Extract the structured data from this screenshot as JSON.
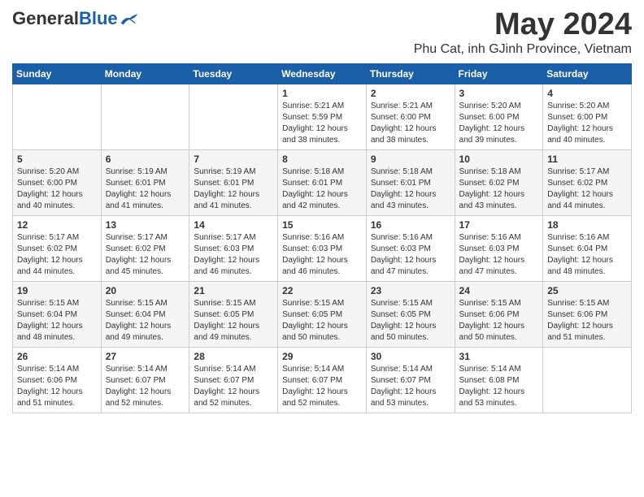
{
  "header": {
    "logo_general": "General",
    "logo_blue": "Blue",
    "month_year": "May 2024",
    "location": "Phu Cat, inh GJinh Province, Vietnam"
  },
  "days_of_week": [
    "Sunday",
    "Monday",
    "Tuesday",
    "Wednesday",
    "Thursday",
    "Friday",
    "Saturday"
  ],
  "weeks": [
    [
      {
        "day": "",
        "sunrise": "",
        "sunset": "",
        "daylight": ""
      },
      {
        "day": "",
        "sunrise": "",
        "sunset": "",
        "daylight": ""
      },
      {
        "day": "",
        "sunrise": "",
        "sunset": "",
        "daylight": ""
      },
      {
        "day": "1",
        "sunrise": "Sunrise: 5:21 AM",
        "sunset": "Sunset: 5:59 PM",
        "daylight": "Daylight: 12 hours and 38 minutes."
      },
      {
        "day": "2",
        "sunrise": "Sunrise: 5:21 AM",
        "sunset": "Sunset: 6:00 PM",
        "daylight": "Daylight: 12 hours and 38 minutes."
      },
      {
        "day": "3",
        "sunrise": "Sunrise: 5:20 AM",
        "sunset": "Sunset: 6:00 PM",
        "daylight": "Daylight: 12 hours and 39 minutes."
      },
      {
        "day": "4",
        "sunrise": "Sunrise: 5:20 AM",
        "sunset": "Sunset: 6:00 PM",
        "daylight": "Daylight: 12 hours and 40 minutes."
      }
    ],
    [
      {
        "day": "5",
        "sunrise": "Sunrise: 5:20 AM",
        "sunset": "Sunset: 6:00 PM",
        "daylight": "Daylight: 12 hours and 40 minutes."
      },
      {
        "day": "6",
        "sunrise": "Sunrise: 5:19 AM",
        "sunset": "Sunset: 6:01 PM",
        "daylight": "Daylight: 12 hours and 41 minutes."
      },
      {
        "day": "7",
        "sunrise": "Sunrise: 5:19 AM",
        "sunset": "Sunset: 6:01 PM",
        "daylight": "Daylight: 12 hours and 41 minutes."
      },
      {
        "day": "8",
        "sunrise": "Sunrise: 5:18 AM",
        "sunset": "Sunset: 6:01 PM",
        "daylight": "Daylight: 12 hours and 42 minutes."
      },
      {
        "day": "9",
        "sunrise": "Sunrise: 5:18 AM",
        "sunset": "Sunset: 6:01 PM",
        "daylight": "Daylight: 12 hours and 43 minutes."
      },
      {
        "day": "10",
        "sunrise": "Sunrise: 5:18 AM",
        "sunset": "Sunset: 6:02 PM",
        "daylight": "Daylight: 12 hours and 43 minutes."
      },
      {
        "day": "11",
        "sunrise": "Sunrise: 5:17 AM",
        "sunset": "Sunset: 6:02 PM",
        "daylight": "Daylight: 12 hours and 44 minutes."
      }
    ],
    [
      {
        "day": "12",
        "sunrise": "Sunrise: 5:17 AM",
        "sunset": "Sunset: 6:02 PM",
        "daylight": "Daylight: 12 hours and 44 minutes."
      },
      {
        "day": "13",
        "sunrise": "Sunrise: 5:17 AM",
        "sunset": "Sunset: 6:02 PM",
        "daylight": "Daylight: 12 hours and 45 minutes."
      },
      {
        "day": "14",
        "sunrise": "Sunrise: 5:17 AM",
        "sunset": "Sunset: 6:03 PM",
        "daylight": "Daylight: 12 hours and 46 minutes."
      },
      {
        "day": "15",
        "sunrise": "Sunrise: 5:16 AM",
        "sunset": "Sunset: 6:03 PM",
        "daylight": "Daylight: 12 hours and 46 minutes."
      },
      {
        "day": "16",
        "sunrise": "Sunrise: 5:16 AM",
        "sunset": "Sunset: 6:03 PM",
        "daylight": "Daylight: 12 hours and 47 minutes."
      },
      {
        "day": "17",
        "sunrise": "Sunrise: 5:16 AM",
        "sunset": "Sunset: 6:03 PM",
        "daylight": "Daylight: 12 hours and 47 minutes."
      },
      {
        "day": "18",
        "sunrise": "Sunrise: 5:16 AM",
        "sunset": "Sunset: 6:04 PM",
        "daylight": "Daylight: 12 hours and 48 minutes."
      }
    ],
    [
      {
        "day": "19",
        "sunrise": "Sunrise: 5:15 AM",
        "sunset": "Sunset: 6:04 PM",
        "daylight": "Daylight: 12 hours and 48 minutes."
      },
      {
        "day": "20",
        "sunrise": "Sunrise: 5:15 AM",
        "sunset": "Sunset: 6:04 PM",
        "daylight": "Daylight: 12 hours and 49 minutes."
      },
      {
        "day": "21",
        "sunrise": "Sunrise: 5:15 AM",
        "sunset": "Sunset: 6:05 PM",
        "daylight": "Daylight: 12 hours and 49 minutes."
      },
      {
        "day": "22",
        "sunrise": "Sunrise: 5:15 AM",
        "sunset": "Sunset: 6:05 PM",
        "daylight": "Daylight: 12 hours and 50 minutes."
      },
      {
        "day": "23",
        "sunrise": "Sunrise: 5:15 AM",
        "sunset": "Sunset: 6:05 PM",
        "daylight": "Daylight: 12 hours and 50 minutes."
      },
      {
        "day": "24",
        "sunrise": "Sunrise: 5:15 AM",
        "sunset": "Sunset: 6:06 PM",
        "daylight": "Daylight: 12 hours and 50 minutes."
      },
      {
        "day": "25",
        "sunrise": "Sunrise: 5:15 AM",
        "sunset": "Sunset: 6:06 PM",
        "daylight": "Daylight: 12 hours and 51 minutes."
      }
    ],
    [
      {
        "day": "26",
        "sunrise": "Sunrise: 5:14 AM",
        "sunset": "Sunset: 6:06 PM",
        "daylight": "Daylight: 12 hours and 51 minutes."
      },
      {
        "day": "27",
        "sunrise": "Sunrise: 5:14 AM",
        "sunset": "Sunset: 6:07 PM",
        "daylight": "Daylight: 12 hours and 52 minutes."
      },
      {
        "day": "28",
        "sunrise": "Sunrise: 5:14 AM",
        "sunset": "Sunset: 6:07 PM",
        "daylight": "Daylight: 12 hours and 52 minutes."
      },
      {
        "day": "29",
        "sunrise": "Sunrise: 5:14 AM",
        "sunset": "Sunset: 6:07 PM",
        "daylight": "Daylight: 12 hours and 52 minutes."
      },
      {
        "day": "30",
        "sunrise": "Sunrise: 5:14 AM",
        "sunset": "Sunset: 6:07 PM",
        "daylight": "Daylight: 12 hours and 53 minutes."
      },
      {
        "day": "31",
        "sunrise": "Sunrise: 5:14 AM",
        "sunset": "Sunset: 6:08 PM",
        "daylight": "Daylight: 12 hours and 53 minutes."
      },
      {
        "day": "",
        "sunrise": "",
        "sunset": "",
        "daylight": ""
      }
    ]
  ]
}
